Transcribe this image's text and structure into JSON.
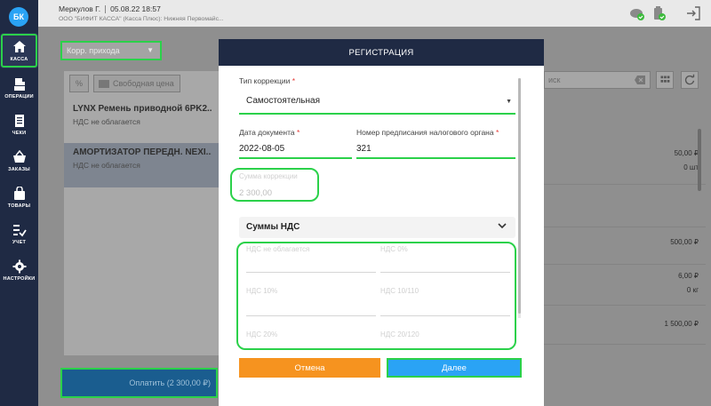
{
  "app": {
    "logo_text": "БК"
  },
  "sidebar": {
    "items": [
      {
        "label": "КАССА",
        "icon": "home-icon",
        "active": true
      },
      {
        "label": "ОПЕРАЦИИ",
        "icon": "register-icon"
      },
      {
        "label": "ЧЕКИ",
        "icon": "receipt-icon"
      },
      {
        "label": "ЗАКАЗЫ",
        "icon": "basket-icon"
      },
      {
        "label": "ТОВАРЫ",
        "icon": "bag-icon"
      },
      {
        "label": "УЧЕТ",
        "icon": "checklist-icon"
      },
      {
        "label": "НАСТРОЙКИ",
        "icon": "gear-icon"
      }
    ]
  },
  "topbar": {
    "user": "Меркулов Г.",
    "datetime": "05.08.22 18:57",
    "org": "ООО \"БИФИТ КАССА\" (Касса Плюс): Нижняя Первомайс..."
  },
  "background": {
    "receipt_type": "Корр. прихода",
    "free_price_btn": "Свободная цена",
    "search_placeholder": "иск",
    "items": [
      {
        "name": "LYNX Ремень приводной 6PK2...",
        "tax": "НДС не облагается"
      },
      {
        "name": "АМОРТИЗАТОР ПЕРЕДН. NEXI...",
        "tax": "НДС не облагается"
      }
    ],
    "prices": [
      {
        "price": "50,00 ₽",
        "qty": "0 шт"
      },
      {
        "price": "500,00 ₽"
      },
      {
        "price": "6,00 ₽",
        "qty": "0 кг"
      },
      {
        "price": "1 500,00 ₽"
      }
    ],
    "pay_button": "Оплатить (2 300,00 ₽)"
  },
  "modal": {
    "title": "РЕГИСТРАЦИЯ",
    "correction_type_label": "Тип коррекции",
    "correction_type_value": "Самостоятельная",
    "doc_date_label": "Дата документа",
    "doc_date_value": "2022-08-05",
    "order_number_label": "Номер предписания налогового органа",
    "order_number_value": "321",
    "correction_sum_label": "Сумма коррекции",
    "correction_sum_value": "2 300,00",
    "vat_section_title": "Суммы НДС",
    "vat_fields": [
      {
        "label": "НДС не облагается"
      },
      {
        "label": "НДС 0%"
      },
      {
        "label": "НДС 10%"
      },
      {
        "label": "НДС 10/110"
      },
      {
        "label": "НДС 20%"
      },
      {
        "label": "НДС 20/120"
      }
    ],
    "cancel_button": "Отмена",
    "next_button": "Далее"
  },
  "colors": {
    "sidebar_bg": "#1f2a44",
    "accent_blue": "#2aa3f5",
    "cancel_orange": "#f6931f",
    "highlight_green": "#2bd14a"
  }
}
